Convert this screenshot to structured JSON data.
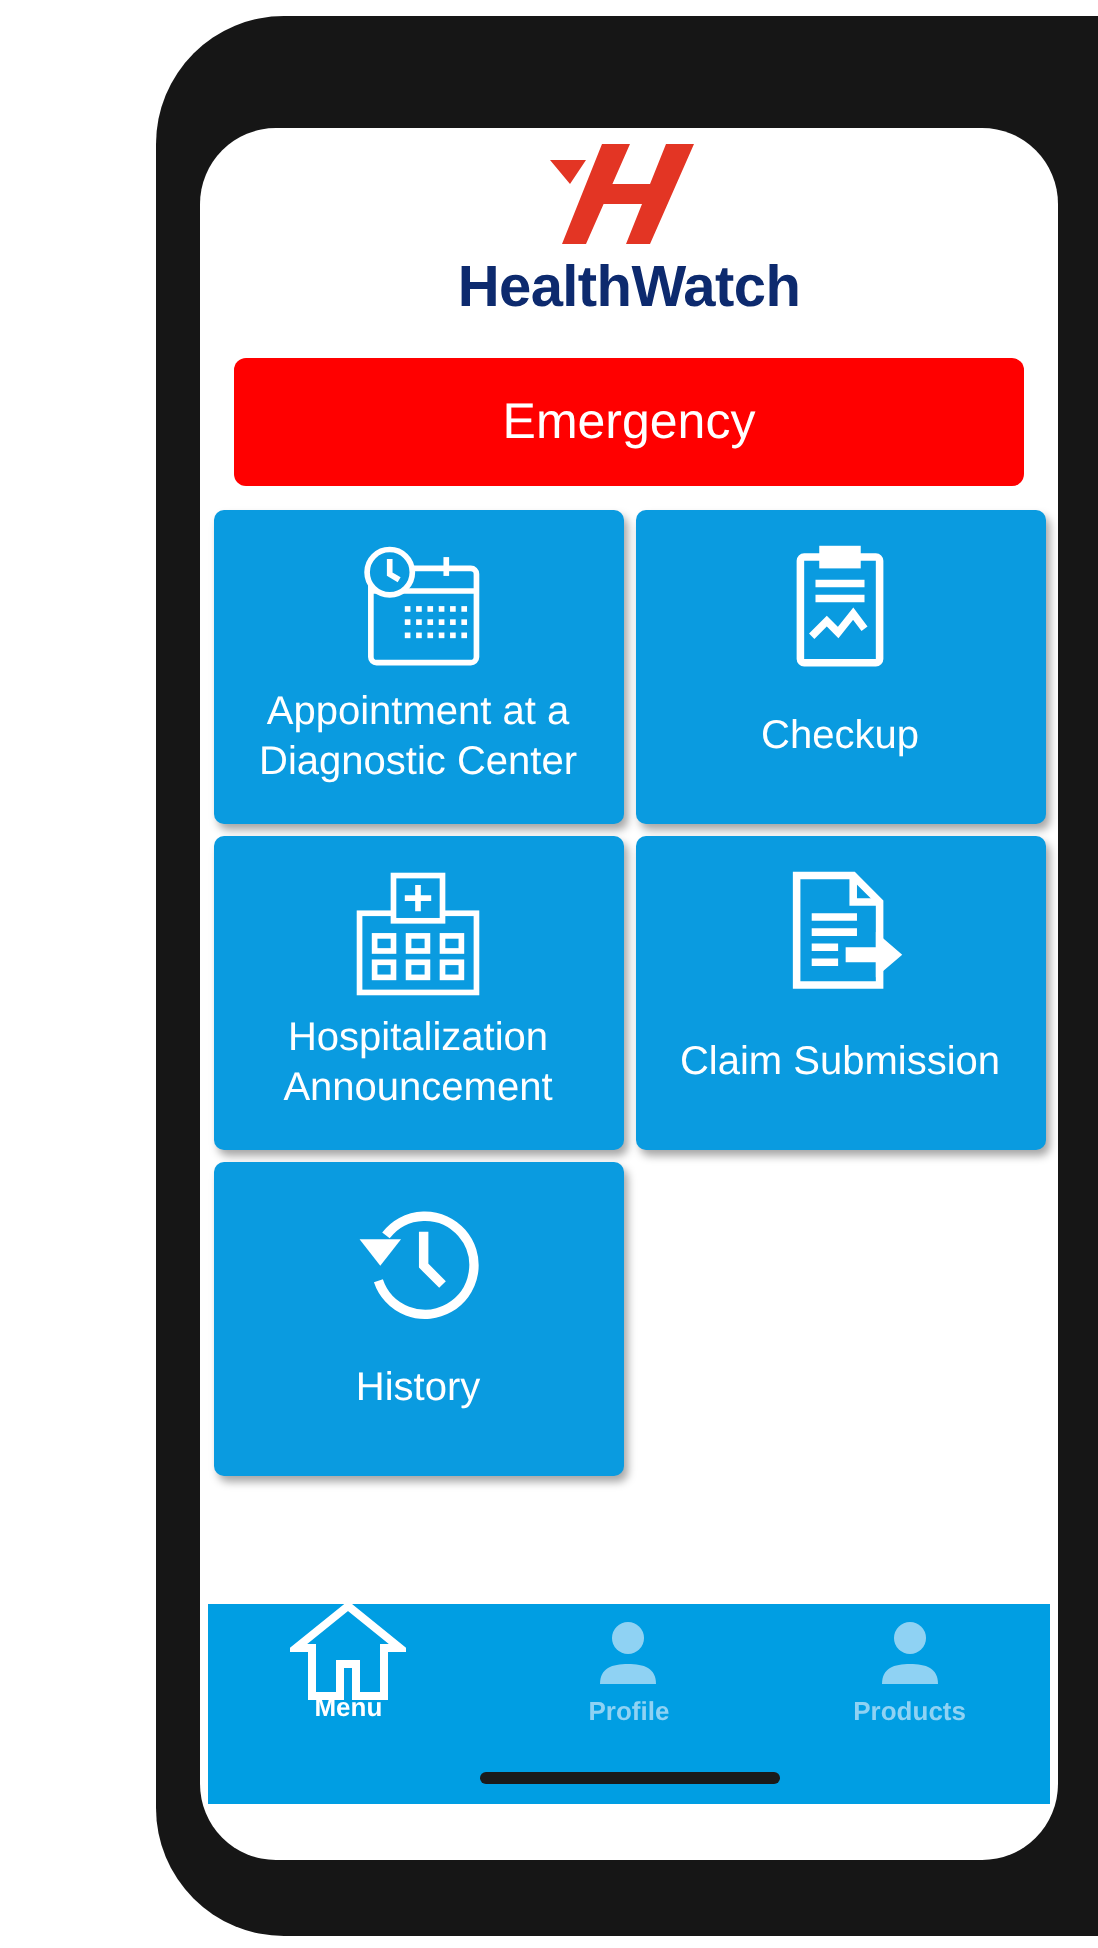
{
  "header": {
    "brand": "HealthWatch"
  },
  "emergency": {
    "label": "Emergency"
  },
  "tiles": [
    {
      "kind": "calendar",
      "label": "Appointment at a Diagnostic Center"
    },
    {
      "kind": "clipboard",
      "label": "Checkup"
    },
    {
      "kind": "hospital",
      "label": "Hospitalization Announcement"
    },
    {
      "kind": "document",
      "label": "Claim Submission"
    },
    {
      "kind": "history",
      "label": "History"
    }
  ],
  "tab_bar": [
    {
      "kind": "home",
      "label": "Menu",
      "selected": true
    },
    {
      "kind": "person",
      "label": "Profile",
      "selected": false
    },
    {
      "kind": "person",
      "label": "Products",
      "selected": false
    }
  ]
}
